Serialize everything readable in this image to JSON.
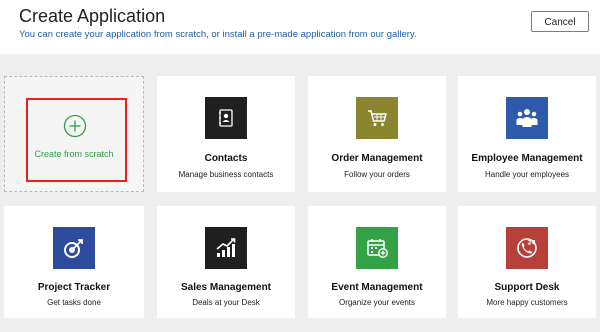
{
  "header": {
    "title": "Create Application",
    "subtitle": "You can create your application from scratch, or install a pre-made application from our gallery.",
    "cancel_label": "Cancel"
  },
  "scratch": {
    "label": "Create from scratch"
  },
  "apps": [
    {
      "name": "Contacts",
      "desc": "Manage business contacts",
      "color": "#1f1f1f",
      "icon": "contacts-icon"
    },
    {
      "name": "Order Management",
      "desc": "Follow your orders",
      "color": "#8c8530",
      "icon": "cart-icon"
    },
    {
      "name": "Employee Management",
      "desc": "Handle your employees",
      "color": "#2e5aab",
      "icon": "team-icon"
    },
    {
      "name": "Project Tracker",
      "desc": "Get tasks done",
      "color": "#2f4b9e",
      "icon": "target-icon"
    },
    {
      "name": "Sales Management",
      "desc": "Deals at your Desk",
      "color": "#1f1f1f",
      "icon": "chart-growth-icon"
    },
    {
      "name": "Event Management",
      "desc": "Organize your events",
      "color": "#33a146",
      "icon": "calendar-icon"
    },
    {
      "name": "Support Desk",
      "desc": "More happy customers",
      "color": "#b8403b",
      "icon": "support-24-icon"
    }
  ]
}
